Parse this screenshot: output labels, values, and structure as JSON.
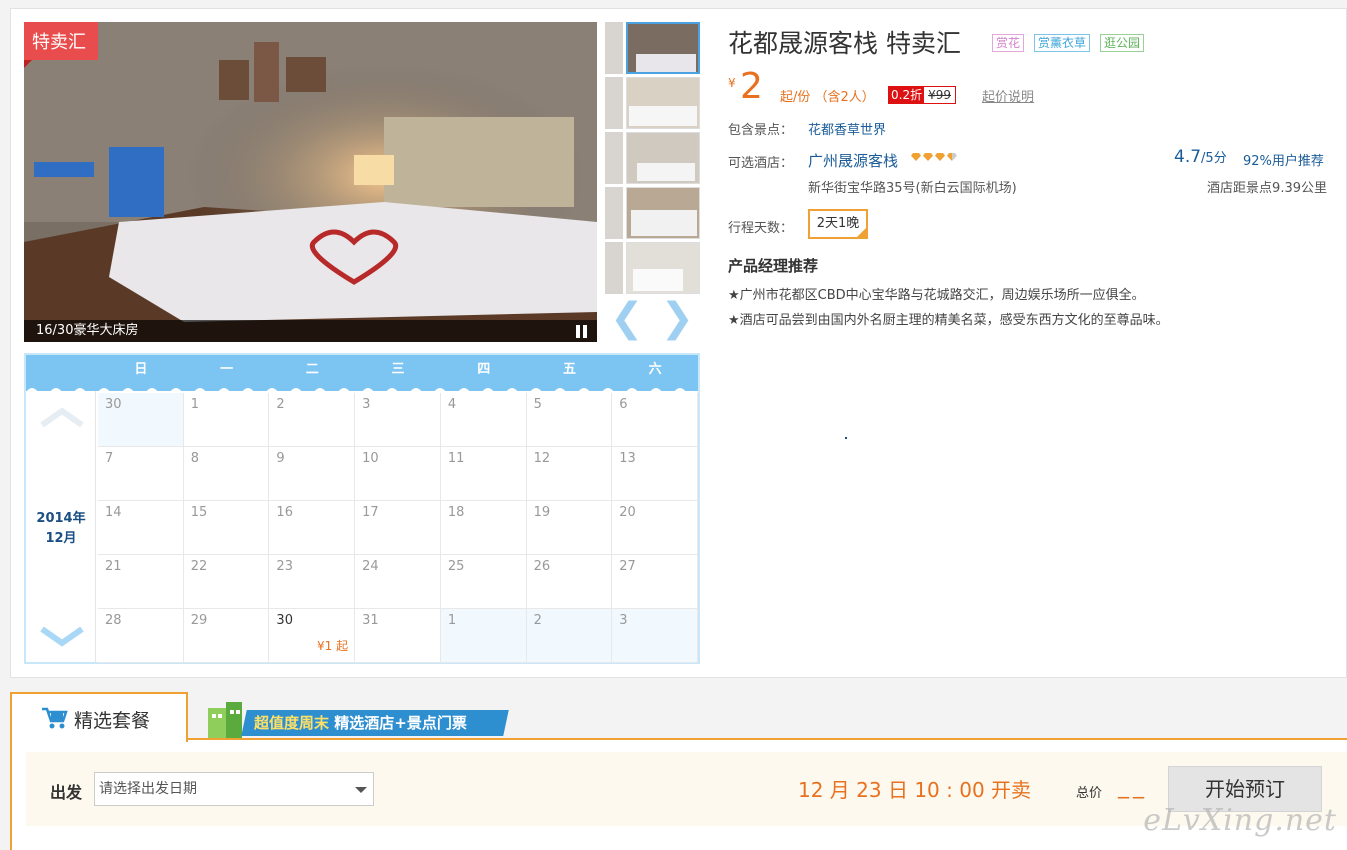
{
  "gallery": {
    "sale_badge": "特卖汇",
    "caption": "16/30豪华大床房",
    "prev_arrow": "❮",
    "next_arrow": "❯"
  },
  "calendar": {
    "weekdays": [
      "日",
      "一",
      "二",
      "三",
      "四",
      "五",
      "六"
    ],
    "year_label": "2014年",
    "month_label": "12月",
    "weeks": [
      [
        "30",
        "1",
        "2",
        "3",
        "4",
        "5",
        "6"
      ],
      [
        "7",
        "8",
        "9",
        "10",
        "11",
        "12",
        "13"
      ],
      [
        "14",
        "15",
        "16",
        "17",
        "18",
        "19",
        "20"
      ],
      [
        "21",
        "22",
        "23",
        "24",
        "25",
        "26",
        "27"
      ],
      [
        "28",
        "29",
        "30",
        "31",
        "1",
        "2",
        "3"
      ]
    ],
    "price_note": "¥1 起"
  },
  "product": {
    "title": "花都晟源客栈 特卖汇",
    "tags": [
      "赏花",
      "赏薰衣草",
      "逛公园"
    ],
    "currency": "¥",
    "price": "2",
    "price_unit": "起/份 （含2人）",
    "discount": "0.2折",
    "original_price": "¥99",
    "price_explain": "起价说明",
    "attractions_label": "包含景点：",
    "attraction": "花都香草世界",
    "hotel_label": "可选酒店：",
    "hotel_name": "广州晟源客栈",
    "hotel_address": "新华街宝华路35号(新白云国际机场)",
    "score": "4.7",
    "score_unit": "/5分",
    "recommend": "92%用户推荐",
    "distance": "酒店距景点9.39公里",
    "days_label": "行程天数：",
    "days_option": "2天1晚",
    "pm_title": "产品经理推荐",
    "pm_lines": [
      "★广州市花都区CBD中心宝华路与花城路交汇，周边娱乐场所一应俱全。",
      "★酒店可品尝到由国内外名厨主理的精美名菜，感受东西方文化的至尊品味。"
    ]
  },
  "tabs": {
    "selected": "精选套餐",
    "banner_part1": "超值度周末",
    "banner_part2": "精选酒店+景点门票"
  },
  "booking": {
    "depart_label": "出发",
    "date_placeholder": "请选择出发日期",
    "sale_time": "12 月 23 日  10 : 00 开卖",
    "total_label": "总价",
    "total_value": "__",
    "book_button": "开始预订"
  },
  "watermark": "eLvXing.net",
  "colors": {
    "accent_orange": "#e8711f",
    "calendar_blue": "#7cc4f2",
    "link_blue": "#1b5c98",
    "discount_red": "#dd1111"
  }
}
